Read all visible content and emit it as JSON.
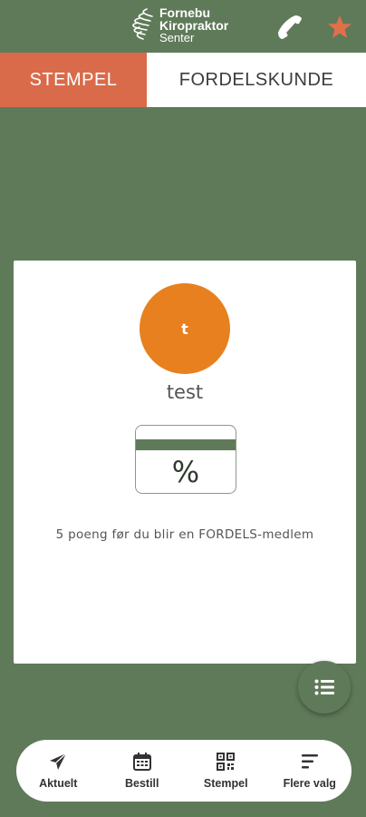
{
  "header": {
    "logo_line1": "Fornebu",
    "logo_line2": "Kiropraktor",
    "logo_line3": "Senter",
    "phone_icon": "phone-icon",
    "star_icon": "star-icon",
    "star_color": "#e0704a"
  },
  "tabs": [
    {
      "label": "STEMPEL",
      "active": true
    },
    {
      "label": "FORDELSKUNDE",
      "active": false
    }
  ],
  "profile": {
    "avatar_initial": "t",
    "avatar_color": "#e8801f",
    "name": "test"
  },
  "member_card": {
    "symbol": "%"
  },
  "points_message": "5 poeng før du blir en FORDELS-medlem",
  "fab": {
    "icon": "list-icon"
  },
  "bottom_nav": [
    {
      "label": "Aktuelt",
      "icon": "send-icon"
    },
    {
      "label": "Bestill",
      "icon": "calendar-icon"
    },
    {
      "label": "Stempel",
      "icon": "qr-code-icon"
    },
    {
      "label": "Flere valg",
      "icon": "menu-icon"
    }
  ],
  "colors": {
    "background": "#5f7a59",
    "accent": "#d96b4b",
    "white": "#ffffff"
  }
}
